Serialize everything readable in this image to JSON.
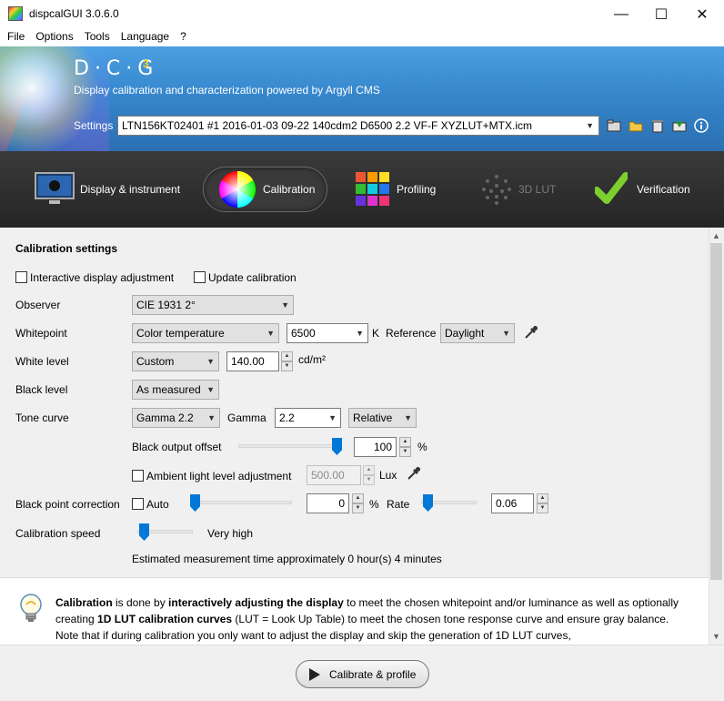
{
  "window": {
    "title": "dispcalGUI 3.0.6.0",
    "minimize": "—",
    "maximize": "☐",
    "close": "✕"
  },
  "menu": [
    "File",
    "Options",
    "Tools",
    "Language",
    "?"
  ],
  "header": {
    "logo": "D·C·G",
    "logo_sup": "3",
    "subtitle": "Display calibration and characterization powered by Argyll CMS",
    "settings_label": "Settings",
    "settings_value": "LTN156KT02401 #1 2016-01-03 09-22 140cdm2 D6500 2.2 VF-F XYZLUT+MTX.icm"
  },
  "tabs": {
    "display": "Display & instrument",
    "calibration": "Calibration",
    "profiling": "Profiling",
    "lut3d": "3D LUT",
    "verification": "Verification"
  },
  "calibration": {
    "section_title": "Calibration settings",
    "interactive_label": "Interactive display adjustment",
    "update_label": "Update calibration",
    "observer_label": "Observer",
    "observer_value": "CIE 1931 2°",
    "whitepoint_label": "Whitepoint",
    "whitepoint_mode": "Color temperature",
    "whitepoint_value": "6500",
    "whitepoint_unit": "K",
    "reference_label": "Reference",
    "reference_value": "Daylight",
    "white_level_label": "White level",
    "white_level_mode": "Custom",
    "white_level_value": "140.00",
    "white_level_unit": "cd/m²",
    "black_level_label": "Black level",
    "black_level_mode": "As measured",
    "tone_curve_label": "Tone curve",
    "tone_curve_mode": "Gamma 2.2",
    "gamma_label": "Gamma",
    "gamma_value": "2.2",
    "gamma_type": "Relative",
    "black_offset_label": "Black output offset",
    "black_offset_value": "100",
    "black_offset_level": 1.0,
    "percent": "%",
    "ambient_label": "Ambient light level adjustment",
    "ambient_value": "500.00",
    "ambient_unit": "Lux",
    "bpc_label": "Black point correction",
    "bpc_auto_label": "Auto",
    "bpc_value": "0",
    "bpc_level": 0.0,
    "rate_label": "Rate",
    "rate_value": "0.06",
    "speed_label": "Calibration speed",
    "speed_value": "Very high",
    "estimate": "Estimated measurement time approximately 0 hour(s) 4 minutes"
  },
  "info": {
    "w1": "Calibration",
    "t1": " is done by ",
    "w2": "interactively adjusting the display",
    "t2": " to meet the chosen whitepoint and/or luminance as well as optionally creating ",
    "w3": "1D LUT calibration curves",
    "t3": " (LUT = Look Up Table) to meet the chosen tone response curve and ensure gray balance. Note that if during calibration you only want to adjust the display and skip the generation of 1D LUT curves,"
  },
  "footer": {
    "button": "Calibrate & profile"
  },
  "colors": {
    "accent": "#0078d7",
    "header_blue": "#3787cc",
    "tabbar": "#2a2a2a"
  }
}
